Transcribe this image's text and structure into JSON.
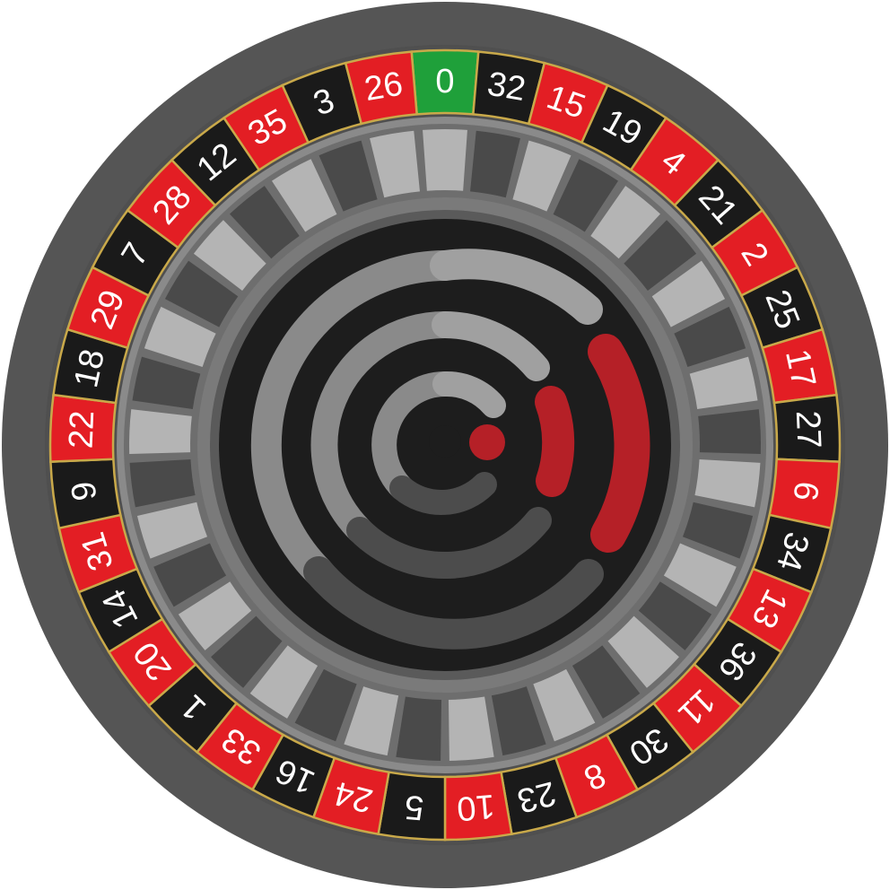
{
  "wheel": {
    "pockets": [
      {
        "number": "0",
        "color": "green"
      },
      {
        "number": "32",
        "color": "black"
      },
      {
        "number": "15",
        "color": "red"
      },
      {
        "number": "19",
        "color": "black"
      },
      {
        "number": "4",
        "color": "red"
      },
      {
        "number": "21",
        "color": "black"
      },
      {
        "number": "2",
        "color": "red"
      },
      {
        "number": "25",
        "color": "black"
      },
      {
        "number": "17",
        "color": "red"
      },
      {
        "number": "27",
        "color": "black"
      },
      {
        "number": "6",
        "color": "red"
      },
      {
        "number": "34",
        "color": "black"
      },
      {
        "number": "13",
        "color": "red"
      },
      {
        "number": "36",
        "color": "black"
      },
      {
        "number": "11",
        "color": "red"
      },
      {
        "number": "30",
        "color": "black"
      },
      {
        "number": "8",
        "color": "red"
      },
      {
        "number": "23",
        "color": "black"
      },
      {
        "number": "10",
        "color": "red"
      },
      {
        "number": "5",
        "color": "black"
      },
      {
        "number": "24",
        "color": "red"
      },
      {
        "number": "16",
        "color": "black"
      },
      {
        "number": "33",
        "color": "red"
      },
      {
        "number": "1",
        "color": "black"
      },
      {
        "number": "20",
        "color": "red"
      },
      {
        "number": "14",
        "color": "black"
      },
      {
        "number": "31",
        "color": "red"
      },
      {
        "number": "9",
        "color": "black"
      },
      {
        "number": "22",
        "color": "red"
      },
      {
        "number": "18",
        "color": "black"
      },
      {
        "number": "29",
        "color": "red"
      },
      {
        "number": "7",
        "color": "black"
      },
      {
        "number": "28",
        "color": "red"
      },
      {
        "number": "12",
        "color": "black"
      },
      {
        "number": "35",
        "color": "red"
      },
      {
        "number": "3",
        "color": "black"
      },
      {
        "number": "26",
        "color": "red"
      }
    ]
  },
  "colors": {
    "red": "#e31e24",
    "black": "#1a1a1a",
    "green": "#1fa03a",
    "gold_divider": "#c9a94a",
    "outer_rim": "#555555",
    "rim_highlight": "#8a8a8a",
    "inner_track": "#6e6e6e",
    "separator_light": "#b4b4b4",
    "separator_dark": "#4a4a4a",
    "hub_bg": "#1d1d1d",
    "logo_red": "#b52027",
    "logo_gray_light": "#8a8a8a",
    "logo_gray_dark": "#4c4c4c"
  },
  "icons": {
    "center_logo": "roulette-spiral-logo-icon"
  }
}
